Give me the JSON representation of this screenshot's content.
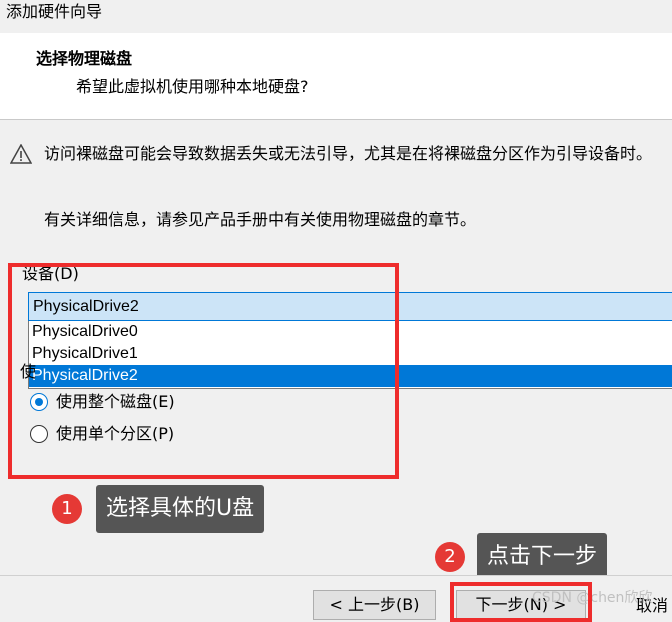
{
  "window": {
    "title": "添加硬件向导"
  },
  "header": {
    "title": "选择物理磁盘",
    "subtitle": "希望此虚拟机使用哪种本地硬盘?"
  },
  "warning": {
    "icon": "warning-triangle-icon",
    "text": "访问裸磁盘可能会导致数据丢失或无法引导，尤其是在将裸磁盘分区作为引导设备时。"
  },
  "info": {
    "text": "有关详细信息，请参见产品手册中有关使用物理磁盘的章节。"
  },
  "device": {
    "label": "设备(D)",
    "selected": "PhysicalDrive2",
    "options": [
      "PhysicalDrive0",
      "PhysicalDrive1",
      "PhysicalDrive2"
    ]
  },
  "usage": {
    "label": "使",
    "options": [
      {
        "label": "使用整个磁盘(E)",
        "checked": true
      },
      {
        "label": "使用单个分区(P)",
        "checked": false
      }
    ]
  },
  "annotations": [
    {
      "number": "1",
      "text": "选择具体的U盘"
    },
    {
      "number": "2",
      "text": "点击下一步"
    }
  ],
  "buttons": {
    "back": "< 上一步(B)",
    "next": "下一步(N) >",
    "cancel": "取消"
  },
  "watermark": "CSDN @chen欣欣",
  "colors": {
    "accent": "#0078d7",
    "annotation_red": "#ee2c2c",
    "callout_bg": "#555555"
  }
}
